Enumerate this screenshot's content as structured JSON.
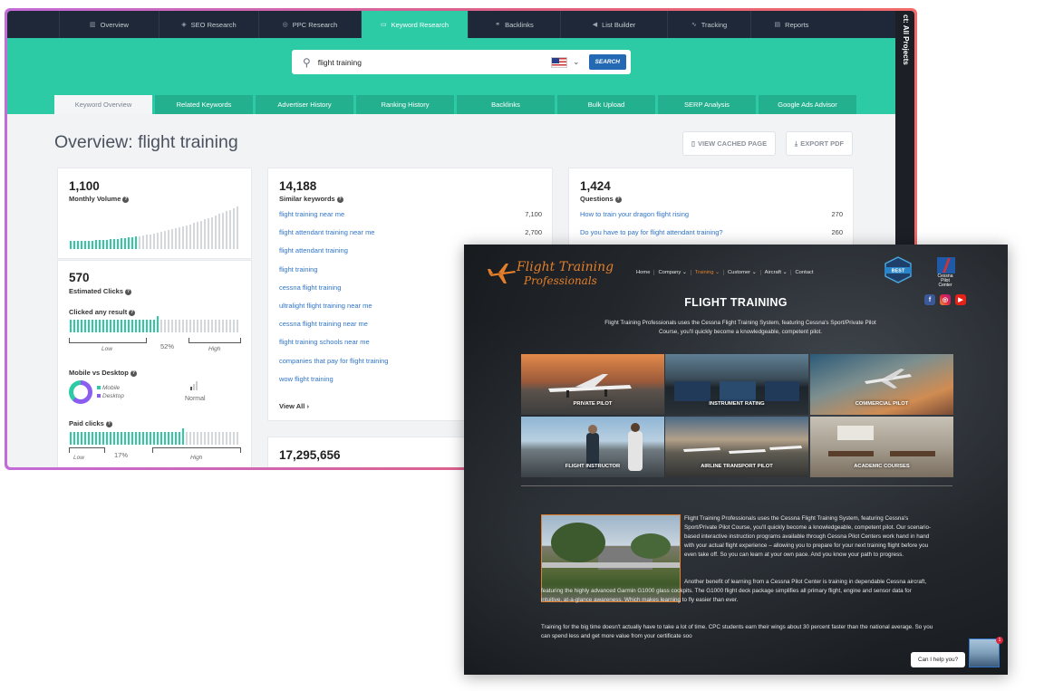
{
  "seo": {
    "top_tabs": [
      {
        "label": "Overview",
        "icon": "bar-chart-icon"
      },
      {
        "label": "SEO Research",
        "icon": "tag-icon"
      },
      {
        "label": "PPC Research",
        "icon": "target-icon"
      },
      {
        "label": "Keyword Research",
        "icon": "keyboard-icon"
      },
      {
        "label": "Backlinks",
        "icon": "link-icon"
      },
      {
        "label": "List Builder",
        "icon": "megaphone-icon"
      },
      {
        "label": "Tracking",
        "icon": "line-chart-icon"
      },
      {
        "label": "Reports",
        "icon": "document-icon"
      }
    ],
    "project_label": "ct: All Projects",
    "search": {
      "value": "flight training",
      "button": "SEARCH"
    },
    "sub_tabs": [
      "Keyword Overview",
      "Related Keywords",
      "Advertiser History",
      "Ranking History",
      "Backlinks",
      "Bulk Upload",
      "SERP Analysis",
      "Google Ads Advisor"
    ],
    "title": "Overview: flight training",
    "view_cached": "VIEW CACHED PAGE",
    "export_pdf": "EXPORT PDF",
    "volume": {
      "value": "1,100",
      "label": "Monthly Volume"
    },
    "clicks": {
      "value": "570",
      "label": "Estimated Clicks"
    },
    "clicked_any": {
      "label": "Clicked any result",
      "percent": "52%",
      "low": "Low",
      "high": "High"
    },
    "mobile_desktop": {
      "label": "Mobile vs Desktop",
      "mobile": "Mobile",
      "desktop": "Desktop",
      "normal": "Normal"
    },
    "paid": {
      "label": "Paid clicks",
      "percent": "17%",
      "low": "Low",
      "high": "High"
    },
    "similar": {
      "value": "14,188",
      "label": "Similar keywords",
      "rows": [
        {
          "kw": "flight training near me",
          "vol": "7,100"
        },
        {
          "kw": "flight attendant training near me",
          "vol": "2,700"
        },
        {
          "kw": "flight attendant training",
          "vol": ""
        },
        {
          "kw": "flight training",
          "vol": ""
        },
        {
          "kw": "cessna flight training",
          "vol": ""
        },
        {
          "kw": "ultralight flight training near me",
          "vol": ""
        },
        {
          "kw": "cessna flight training near me",
          "vol": ""
        },
        {
          "kw": "flight training schools near me",
          "vol": ""
        },
        {
          "kw": "companies that pay for flight training",
          "vol": ""
        },
        {
          "kw": "wow flight training",
          "vol": ""
        }
      ],
      "view_all": "View All"
    },
    "questions": {
      "value": "1,424",
      "label": "Questions",
      "rows": [
        {
          "kw": "How to train your dragon flight rising",
          "vol": "270"
        },
        {
          "kw": "Do you have to pay for flight attendant training?",
          "vol": "260"
        }
      ]
    },
    "other_count": "17,295,656"
  },
  "ftp": {
    "logo_line1": "Flight Training",
    "logo_line2": "Professionals",
    "nav": [
      "Home",
      "Company",
      "Training",
      "Customer",
      "Aircraft",
      "Contact"
    ],
    "badge": "BEST",
    "cessna_label": "Cessna Pilot Center",
    "title": "FLIGHT TRAINING",
    "intro": "Flight Training Professionals uses the Cessna Flight Training System, featuring Cessna's Sport/Private Pilot Course, you'll quickly become a knowledgeable, competent pilot.",
    "tiles": [
      "PRIVATE PILOT",
      "INSTRUMENT RATING",
      "COMMERCIAL PILOT",
      "FLIGHT INSTRUCTOR",
      "AIRLINE TRANSPORT PILOT",
      "ACADEMIC COURSES"
    ],
    "para1": "Flight Training Professionals uses the Cessna Flight Training System, featuring Cessna's Sport/Private Pilot Course, you'll quickly become a knowledgeable, competent pilot. Our scenario-based interactive instruction programs available through Cessna Pilot Centers work hand in hand with your actual flight experience – allowing you to prepare for your next training flight before you even take off. So you can learn at your own pace. And you know your path to progress.",
    "para2": "Another benefit of learning from a Cessna Pilot Center is training in dependable Cessna aircraft, featuring the highly advanced Garmin G1000 glass cockpits. The G1000 flight deck package simplifies all primary flight, engine and sensor data for intuitive, at-a-glance awareness. Which makes learning to fly easier than ever.",
    "para3": "Training for the big time doesn't actually have to take a lot of time. CPC students earn their wings about 30 percent faster than the national average. So you can spend less and get more value from your certificate soo",
    "chat": "Can I help you?",
    "chat_count": "1"
  }
}
